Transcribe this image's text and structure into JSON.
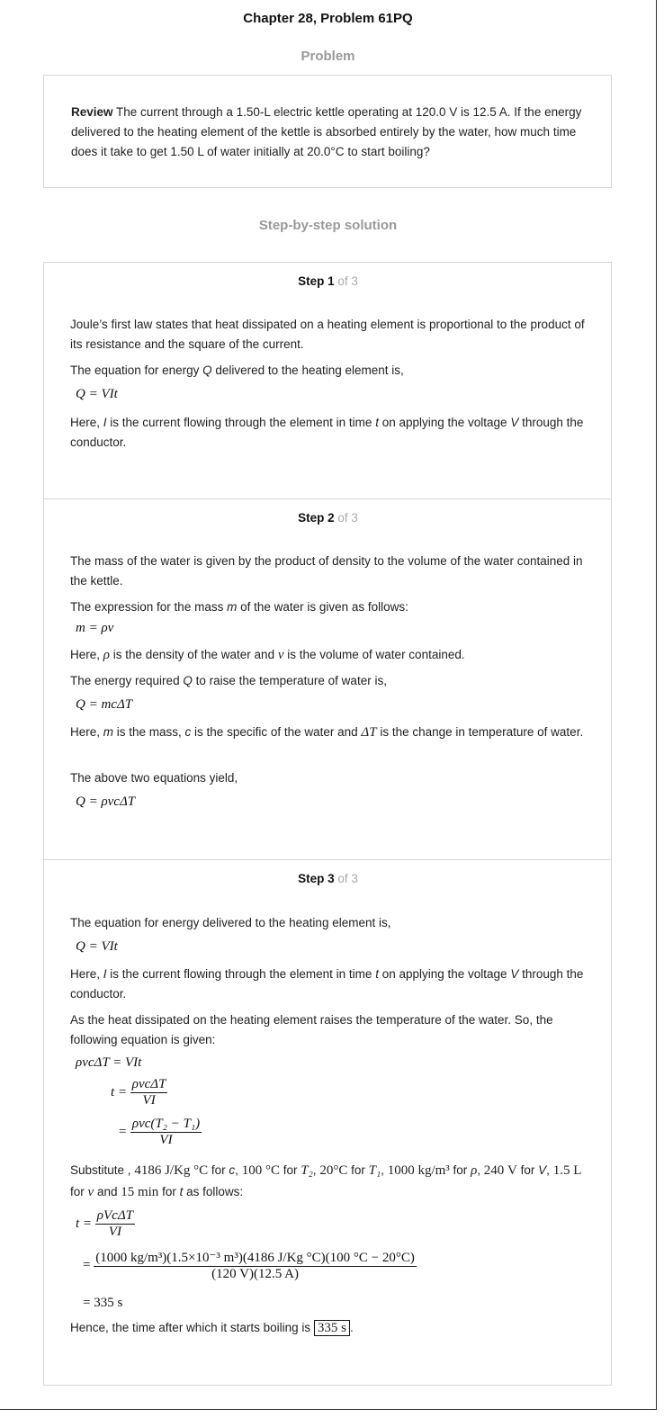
{
  "header": {
    "title": "Chapter 28, Problem 61PQ"
  },
  "problem": {
    "heading": "Problem",
    "lead": "Review",
    "text": " The current through a 1.50-L electric kettle operating at 120.0 V is 12.5 A. If the energy delivered to the heating element of the kettle is absorbed entirely by the water, how much time does it take to get 1.50 L of water initially at 20.0°C to start boiling?"
  },
  "solution": {
    "heading": "Step-by-step solution"
  },
  "steps": [
    {
      "label": "Step 1",
      "of": " of 3",
      "p1": "Joule’s first law states that heat dissipated on a heating element is proportional to the product of its resistance and the square of the current.",
      "p2a": "The equation for energy ",
      "p2v": "Q",
      "p2b": " delivered to the heating element is,",
      "eq1": "Q = VIt",
      "p3a": "Here, ",
      "p3v1": "I",
      "p3b": " is the current flowing through the element in time ",
      "p3v2": "t",
      "p3c": " on applying the voltage ",
      "p3v3": "V",
      "p3d": " through the conductor."
    },
    {
      "label": "Step 2",
      "of": " of 3",
      "p1": "The mass of the water is given by the product of density to the volume of the water contained in the kettle.",
      "p2a": "The expression for the mass ",
      "p2v": "m",
      "p2b": " of the water is given as follows:",
      "eq1": "m = ρv",
      "p3a": "Here, ",
      "p3v1": "ρ",
      "p3b": " is the density of the water and ",
      "p3v2": "v",
      "p3c": " is the volume of water contained.",
      "p4a": "The energy required ",
      "p4v": "Q",
      "p4b": " to raise the temperature of water is,",
      "eq2": "Q = mcΔT",
      "p5a": "Here, ",
      "p5v1": "m",
      "p5b": " is the mass, ",
      "p5v2": "c",
      "p5c": " is the specific of the water and ",
      "p5v3": "ΔT",
      "p5d": " is the change in temperature of water.",
      "p6": "The above two equations yield,",
      "eq3": "Q = ρvcΔT"
    },
    {
      "label": "Step 3",
      "of": " of 3",
      "p1": "The equation for energy delivered to the heating element is,",
      "eq1": "Q = VIt",
      "p2a": "Here, ",
      "p2v1": "I",
      "p2b": " is the current flowing through the element in time ",
      "p2v2": "t",
      "p2c": " on applying the voltage ",
      "p2v3": "V",
      "p2d": " through the conductor.",
      "p3": "As the heat dissipated on the heating element raises the temperature of the water. So, the following equation is given:",
      "eq2": "ρvcΔT = VIt",
      "eq3_lhs": "t =",
      "eq3_num": "ρvcΔT",
      "eq3_den": "VI",
      "eq4_lhs": "=",
      "eq4_num": "ρvc(T₂ − T₁)",
      "eq4_den": "VI",
      "sub": {
        "s1": "Substitute ,",
        "c_val": "4186 J/Kg °C",
        "s2": " for ",
        "c_var": "c",
        "s3": ",",
        "t2_val": "100 °C",
        "s4": " for ",
        "t2_var": "T₂",
        "s5": ",",
        "t1_val": "20°C",
        "s6": " for ",
        "t1_var": "T₁",
        "s7": ",",
        "rho_val": "1000 kg/m³",
        "s8": " for ",
        "rho_var": "ρ",
        "s9": ",",
        "v_val": "240 V",
        "s10": " for ",
        "v_var": "V",
        "s11": ",",
        "vol_val": "1.5 L",
        "s12": " for ",
        "vol_var": "v",
        "s13": " and ",
        "t_val": "15 min",
        "s14": " for ",
        "t_var": "t",
        "s15": " as follows:"
      },
      "eq5_lhs": "t =",
      "eq5_num": "ρVcΔT",
      "eq5_den": "VI",
      "eq6_lhs": "=",
      "eq6_num": "(1000 kg/m³)(1.5×10⁻³ m³)(4186 J/Kg °C)(100 °C − 20°C)",
      "eq6_den": "(120 V)(12.5 A)",
      "eq7": "= 335 s",
      "final_a": "Hence, the time after which it starts boiling is ",
      "final_val": "335 s",
      "final_b": "."
    }
  ]
}
